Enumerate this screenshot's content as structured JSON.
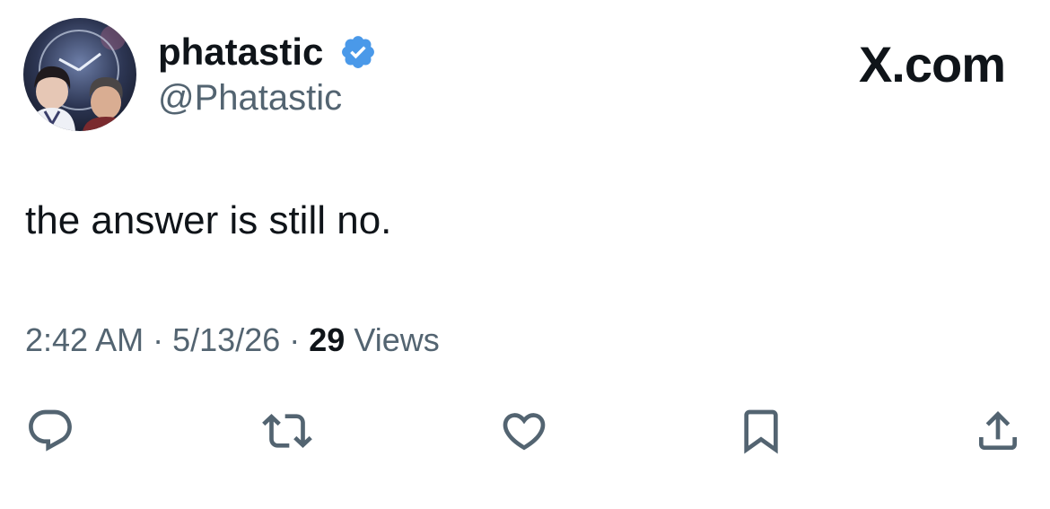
{
  "header": {
    "brand": "X.com",
    "author": {
      "display_name": "phatastic",
      "handle": "@Phatastic",
      "avatar_icon": "profile-avatar",
      "verified_icon": "verified-badge-icon",
      "verified_color": "#4a99e9"
    }
  },
  "tweet": {
    "text": "the answer is still no.",
    "time": "2:42 AM",
    "date": "5/13/26",
    "separator": "·",
    "views_count": "29",
    "views_label": "Views"
  },
  "actions": [
    {
      "name": "reply",
      "icon": "reply-icon"
    },
    {
      "name": "retweet",
      "icon": "retweet-icon"
    },
    {
      "name": "like",
      "icon": "heart-icon"
    },
    {
      "name": "bookmark",
      "icon": "bookmark-icon"
    },
    {
      "name": "share",
      "icon": "share-icon"
    }
  ],
  "colors": {
    "text_primary": "#0f1419",
    "text_secondary": "#536471",
    "icon_gray": "#536471",
    "background": "#ffffff"
  }
}
